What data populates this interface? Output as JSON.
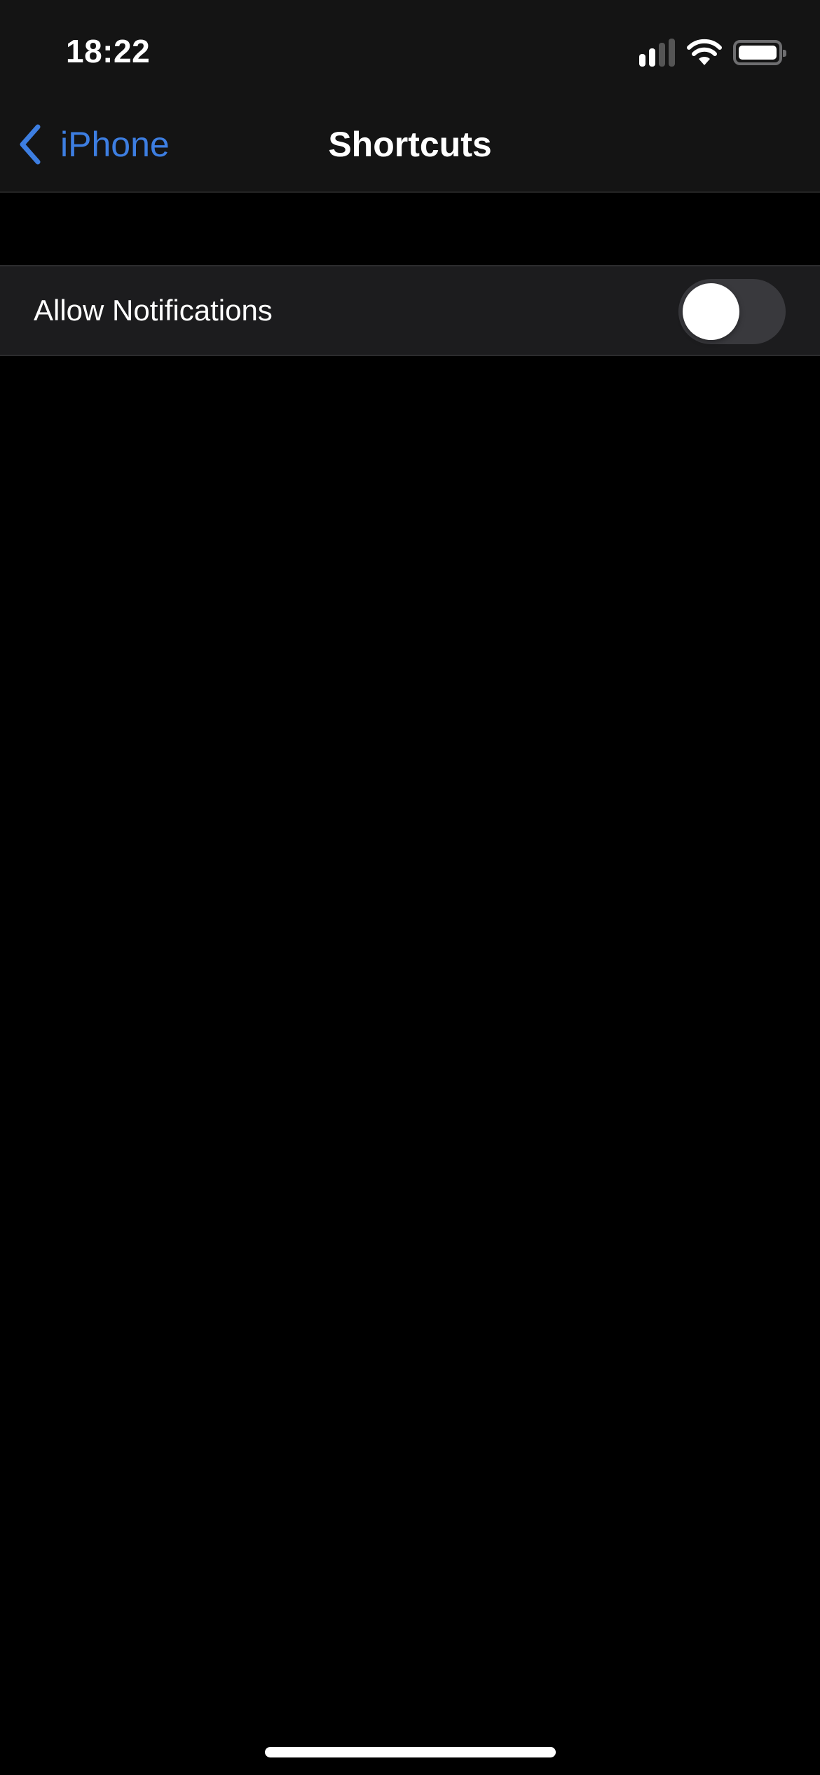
{
  "status_bar": {
    "time": "18:22",
    "icons": [
      "cellular-signal-icon",
      "wifi-icon",
      "battery-icon"
    ],
    "signal_bars_active": 2,
    "signal_bars_total": 4,
    "battery_level": "full"
  },
  "nav_bar": {
    "back_label": "iPhone",
    "back_icon": "chevron-left-icon",
    "title": "Shortcuts"
  },
  "settings": {
    "rows": [
      {
        "label": "Allow Notifications",
        "control": "toggle",
        "value": false
      }
    ]
  },
  "colors": {
    "accent": "#3d7ee1",
    "background": "#000000",
    "header_background": "#141414",
    "cell_background": "#1c1c1e",
    "toggle_off_track": "#39393d"
  }
}
